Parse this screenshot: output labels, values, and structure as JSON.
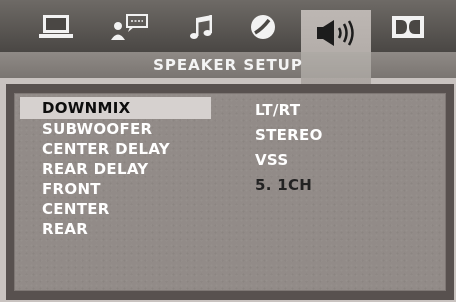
{
  "header": {
    "title": "SPEAKER SETUP",
    "tabs": [
      {
        "icon": "monitor-icon",
        "active": false
      },
      {
        "icon": "language-icon",
        "active": false
      },
      {
        "icon": "audio-icon",
        "active": false
      },
      {
        "icon": "video-icon",
        "active": false
      },
      {
        "icon": "speaker-icon",
        "active": true
      },
      {
        "icon": "dolby-icon",
        "active": false
      }
    ]
  },
  "menu": {
    "items": [
      {
        "label": "DOWNMIX",
        "selected": true
      },
      {
        "label": "SUBWOOFER",
        "selected": false
      },
      {
        "label": "CENTER DELAY",
        "selected": false
      },
      {
        "label": "REAR DELAY",
        "selected": false
      },
      {
        "label": "FRONT",
        "selected": false
      },
      {
        "label": "CENTER",
        "selected": false
      },
      {
        "label": "REAR",
        "selected": false
      }
    ]
  },
  "options": {
    "items": [
      {
        "label": "LT/RT"
      },
      {
        "label": "STEREO"
      },
      {
        "label": "VSS"
      },
      {
        "label": "5. 1CH",
        "current": true
      }
    ]
  },
  "colors": {
    "icon_bar": "#5a5652",
    "title_band": "#847f7b",
    "panel": "#928b88",
    "highlight": "#d6d1cf",
    "text": "#ffffff"
  }
}
